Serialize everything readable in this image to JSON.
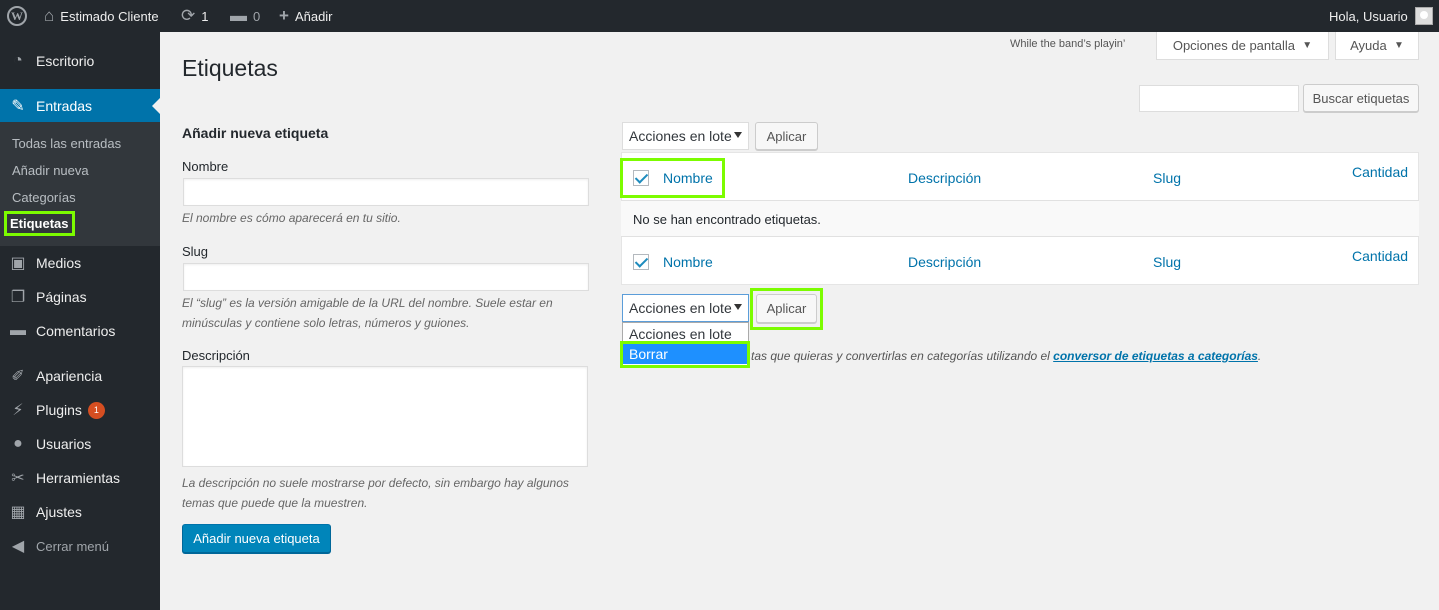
{
  "adminbar": {
    "site_name": "Estimado Cliente",
    "updates_count": "1",
    "comments_count": "0",
    "new_label": "Añadir",
    "greeting": "Hola, Usuario"
  },
  "menu": {
    "items": [
      {
        "label": "Escritorio",
        "icon": "dashboard-icon"
      },
      {
        "label": "Entradas",
        "icon": "pin-icon"
      },
      {
        "label": "Medios",
        "icon": "media-icon"
      },
      {
        "label": "Páginas",
        "icon": "pages-icon"
      },
      {
        "label": "Comentarios",
        "icon": "comments-icon"
      },
      {
        "label": "Apariencia",
        "icon": "appearance-icon"
      },
      {
        "label": "Plugins",
        "icon": "plugins-icon",
        "badge": "1"
      },
      {
        "label": "Usuarios",
        "icon": "users-icon"
      },
      {
        "label": "Herramientas",
        "icon": "tools-icon"
      },
      {
        "label": "Ajustes",
        "icon": "settings-icon"
      },
      {
        "label": "Cerrar menú",
        "icon": "collapse-icon"
      }
    ],
    "submenu": [
      "Todas las entradas",
      "Añadir nueva",
      "Categorías",
      "Etiquetas"
    ]
  },
  "header": {
    "hello_dolly": "While the band’s playin’",
    "screen_options": "Opciones de pantalla",
    "help": "Ayuda",
    "title": "Etiquetas"
  },
  "search": {
    "button": "Buscar etiquetas",
    "value": ""
  },
  "form": {
    "heading": "Añadir nueva etiqueta",
    "name_label": "Nombre",
    "name_help": "El nombre es cómo aparecerá en tu sitio.",
    "slug_label": "Slug",
    "slug_help_1": "El “slug” es la versión amigable de la URL del nombre. Suele estar en",
    "slug_help_2": "minúsculas y contiene solo letras, números y guiones.",
    "desc_label": "Descripción",
    "desc_help_1": "La descripción no suele mostrarse por defecto, sin embargo hay algunos",
    "desc_help_2": "temas que puede que la muestren.",
    "submit": "Añadir nueva etiqueta"
  },
  "bulk": {
    "select_label": "Acciones en lote",
    "apply": "Aplicar",
    "options": [
      "Acciones en lote",
      "Borrar"
    ]
  },
  "table": {
    "columns": [
      "Nombre",
      "Descripción",
      "Slug",
      "Cantidad"
    ],
    "empty": "No se han encontrado etiquetas."
  },
  "note": {
    "text": "tas que quieras y convertirlas en categorías utilizando el ",
    "link": "conversor de etiquetas a categorías",
    "tail": "."
  },
  "colors": {
    "accent": "#0073aa",
    "highlight": "#7cfc00",
    "menu_bg": "#23282d"
  }
}
